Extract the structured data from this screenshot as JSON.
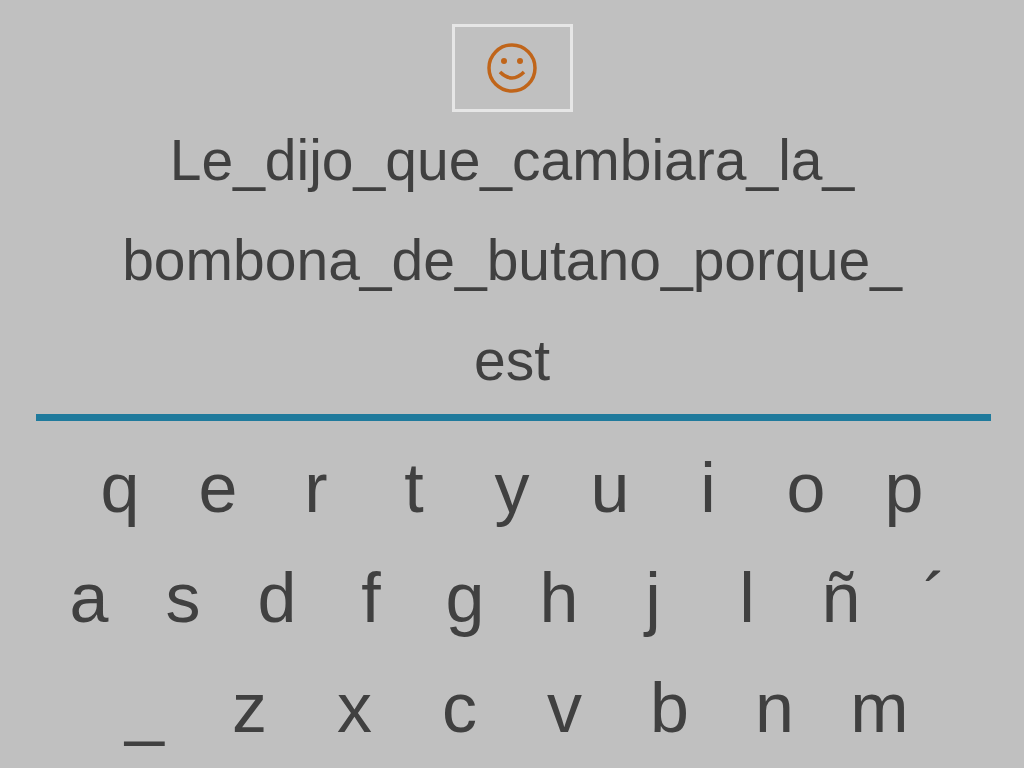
{
  "sentence_lines": [
    "Le_dijo_que_cambiara_la_",
    "bombona_de_butano_porque_",
    "est"
  ],
  "keyboard_rows": [
    [
      "q",
      "e",
      "r",
      "t",
      "y",
      "u",
      "i",
      "o",
      "p"
    ],
    [
      "a",
      "s",
      "d",
      "f",
      "g",
      "h",
      "j",
      "l",
      "ñ",
      "´"
    ],
    [
      "_",
      "z",
      "x",
      "c",
      "v",
      "b",
      "n",
      "m"
    ]
  ]
}
